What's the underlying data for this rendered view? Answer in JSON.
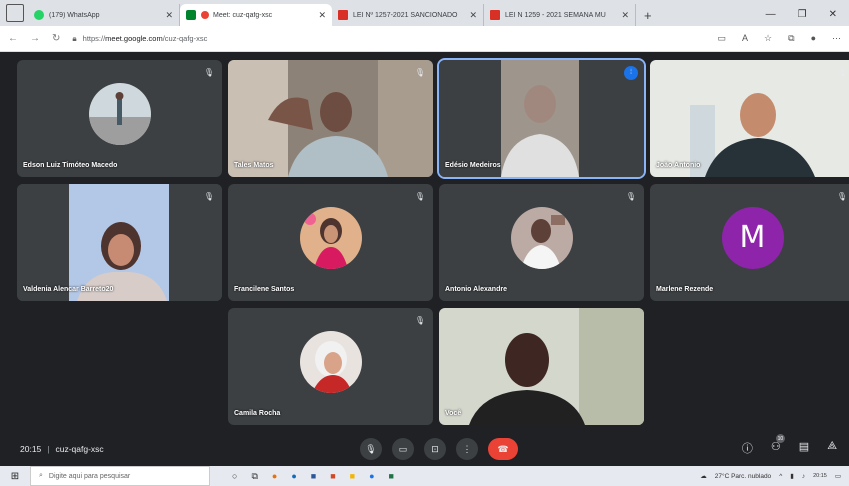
{
  "browser": {
    "tabs": [
      {
        "title": "(179) WhatsApp",
        "icon": "whatsapp-icon",
        "color": "#25d366"
      },
      {
        "title": "Meet: cuz-qafg-xsc",
        "icon": "meet-icon",
        "color": "#ea4335",
        "active": true
      },
      {
        "title": "LEI Nº 1257-2021 SANCIONADO",
        "icon": "pdf-icon",
        "color": "#d93025"
      },
      {
        "title": "LEI N 1259 - 2021 SEMANA MU",
        "icon": "pdf-icon",
        "color": "#d93025"
      }
    ],
    "url_prefix": "https://",
    "url_domain": "meet.google.com",
    "url_path": "/cuz-qafg-xsc"
  },
  "participants": [
    {
      "name": "Edson Luiz Timóteo Macedo",
      "kind": "avatar-photo",
      "muted": true
    },
    {
      "name": "Tales Matos",
      "kind": "video",
      "muted": true
    },
    {
      "name": "Edésio Medeiros",
      "kind": "video",
      "speaking": true
    },
    {
      "name": "João Antonio",
      "kind": "video",
      "muted": true
    },
    {
      "name": "Valdenia Alencar Barreto20",
      "kind": "video",
      "muted": true
    },
    {
      "name": "Francilene Santos",
      "kind": "avatar-photo",
      "muted": true
    },
    {
      "name": "Antonio Alexandre",
      "kind": "avatar-photo",
      "muted": true
    },
    {
      "name": "Marlene Rezende",
      "kind": "avatar-letter",
      "letter": "M",
      "muted": true
    },
    {
      "name": "Camila Rocha",
      "kind": "avatar-photo",
      "muted": true
    },
    {
      "name": "Você",
      "kind": "video"
    }
  ],
  "meeting": {
    "time": "20:15",
    "code": "cuz-qafg-xsc",
    "participant_count": "10"
  },
  "taskbar": {
    "search_placeholder": "Digite aqui para pesquisar",
    "weather": "27°C Parc. nublado",
    "time": "20:15"
  },
  "colors": {
    "meet_bg": "#202124",
    "tile_bg": "#3c4043",
    "end_call": "#ea4335",
    "speaking_outline": "#8ab4f8",
    "letter_avatar": "#8e24aa"
  }
}
